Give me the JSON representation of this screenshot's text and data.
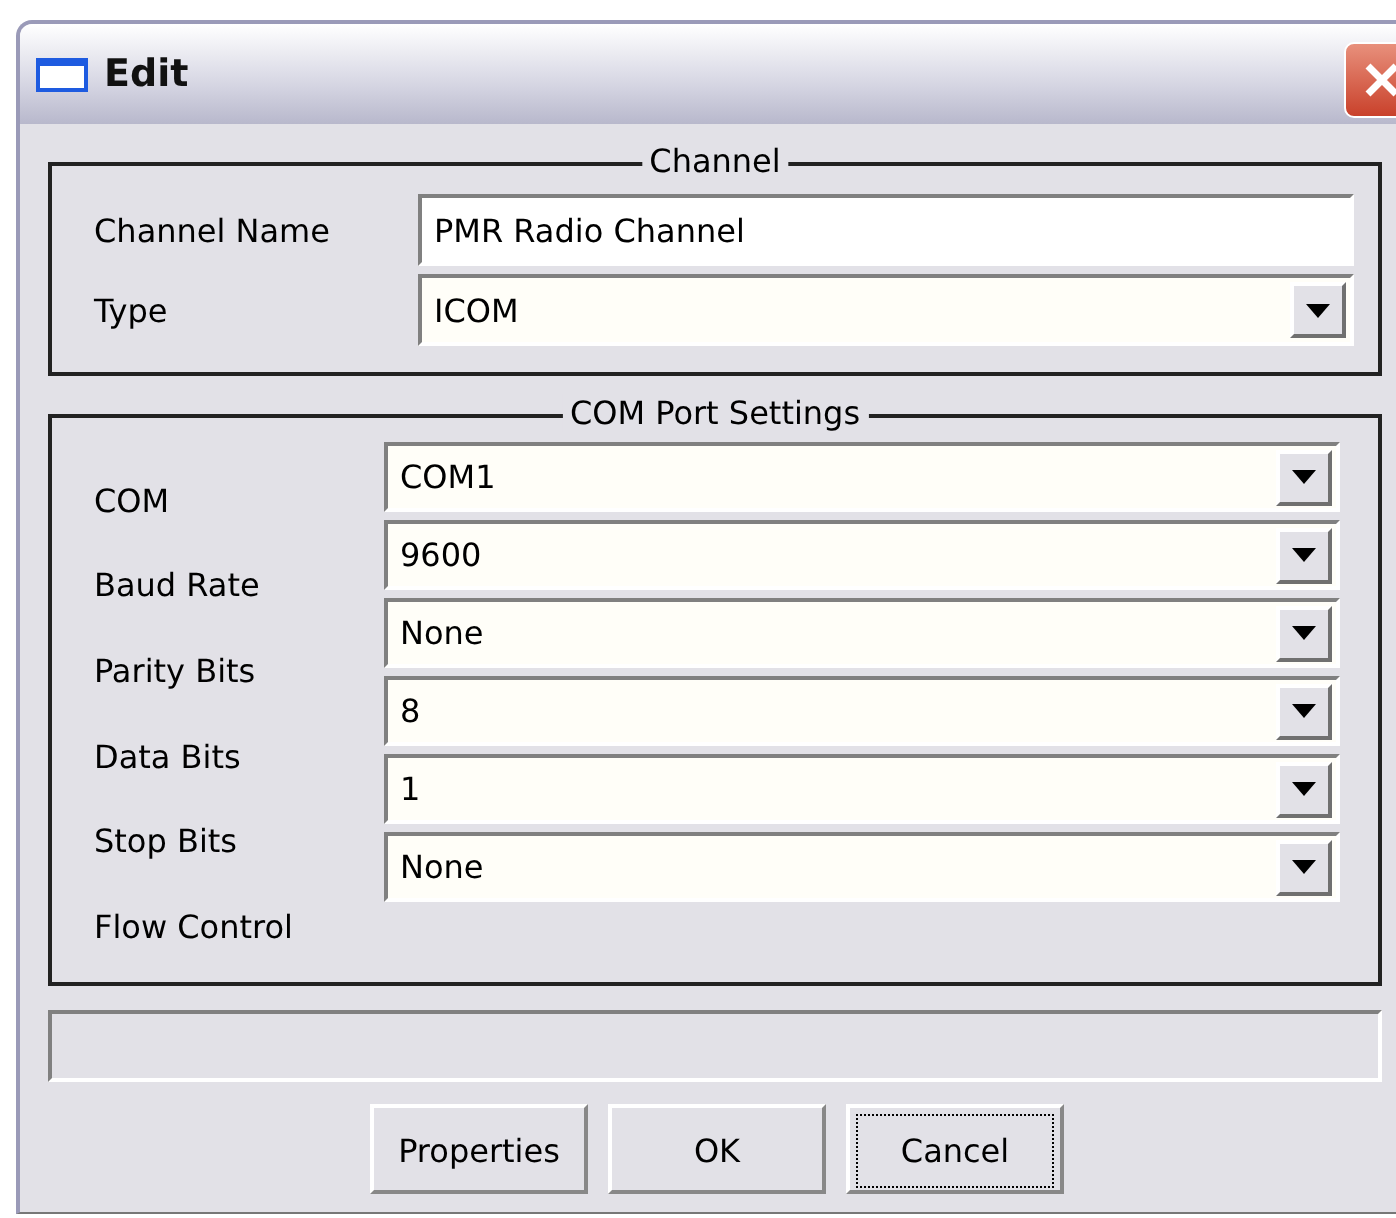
{
  "window": {
    "title": "Edit"
  },
  "channel_group": {
    "title": "Channel",
    "fields": [
      {
        "kind": "text",
        "label": "Channel Name",
        "value": "PMR Radio Channel"
      },
      {
        "kind": "dropdown",
        "label": "Type",
        "value": "ICOM"
      }
    ]
  },
  "com_group": {
    "title": "COM Port Settings",
    "fields": [
      {
        "label": "COM",
        "value": "COM1"
      },
      {
        "label": "Baud Rate",
        "value": "9600"
      },
      {
        "label": "Parity Bits",
        "value": "None"
      },
      {
        "label": "Data Bits",
        "value": "8"
      },
      {
        "label": "Stop Bits",
        "value": "1"
      },
      {
        "label": "Flow Control",
        "value": "None"
      }
    ]
  },
  "buttons": [
    {
      "label": "Properties",
      "focused": false
    },
    {
      "label": "OK",
      "focused": false
    },
    {
      "label": "Cancel",
      "focused": true
    }
  ]
}
